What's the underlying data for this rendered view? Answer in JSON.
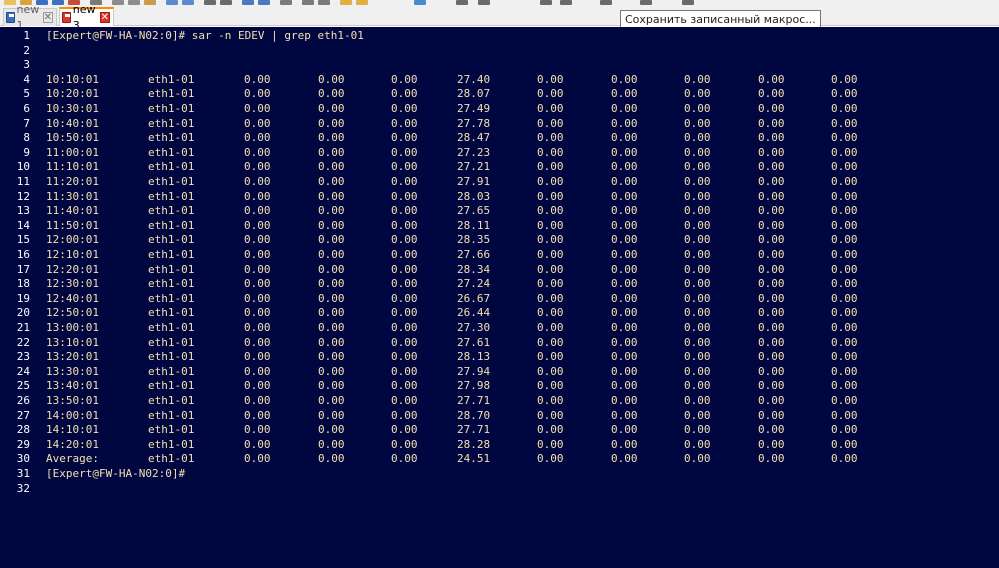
{
  "window": {
    "tabs": [
      {
        "label": "new 1",
        "active": false,
        "icon": "save-disk-icon"
      },
      {
        "label": "new 3",
        "active": true,
        "icon": "unsaved-disk-icon"
      }
    ],
    "tooltip": "Сохранить записанный макрос..."
  },
  "colors": {
    "editor_background": "#000640",
    "text": "#f3e0b0",
    "line_number": "#ffffff",
    "active_tab_accent": "#ff8a00"
  },
  "editor": {
    "command_line": {
      "line": "1",
      "text": "[Expert@FW-HA-N02:0]# sar -n EDEV | grep eth1-01"
    },
    "blank_lines": [
      "2",
      "3"
    ],
    "rows": [
      {
        "line": "4",
        "time": "10:10:01",
        "iface": "eth1-01",
        "values": [
          "0.00",
          "0.00",
          "0.00",
          "27.40",
          "0.00",
          "0.00",
          "0.00",
          "0.00",
          "0.00"
        ]
      },
      {
        "line": "5",
        "time": "10:20:01",
        "iface": "eth1-01",
        "values": [
          "0.00",
          "0.00",
          "0.00",
          "28.07",
          "0.00",
          "0.00",
          "0.00",
          "0.00",
          "0.00"
        ]
      },
      {
        "line": "6",
        "time": "10:30:01",
        "iface": "eth1-01",
        "values": [
          "0.00",
          "0.00",
          "0.00",
          "27.49",
          "0.00",
          "0.00",
          "0.00",
          "0.00",
          "0.00"
        ]
      },
      {
        "line": "7",
        "time": "10:40:01",
        "iface": "eth1-01",
        "values": [
          "0.00",
          "0.00",
          "0.00",
          "27.78",
          "0.00",
          "0.00",
          "0.00",
          "0.00",
          "0.00"
        ]
      },
      {
        "line": "8",
        "time": "10:50:01",
        "iface": "eth1-01",
        "values": [
          "0.00",
          "0.00",
          "0.00",
          "28.47",
          "0.00",
          "0.00",
          "0.00",
          "0.00",
          "0.00"
        ]
      },
      {
        "line": "9",
        "time": "11:00:01",
        "iface": "eth1-01",
        "values": [
          "0.00",
          "0.00",
          "0.00",
          "27.23",
          "0.00",
          "0.00",
          "0.00",
          "0.00",
          "0.00"
        ]
      },
      {
        "line": "10",
        "time": "11:10:01",
        "iface": "eth1-01",
        "values": [
          "0.00",
          "0.00",
          "0.00",
          "27.21",
          "0.00",
          "0.00",
          "0.00",
          "0.00",
          "0.00"
        ]
      },
      {
        "line": "11",
        "time": "11:20:01",
        "iface": "eth1-01",
        "values": [
          "0.00",
          "0.00",
          "0.00",
          "27.91",
          "0.00",
          "0.00",
          "0.00",
          "0.00",
          "0.00"
        ]
      },
      {
        "line": "12",
        "time": "11:30:01",
        "iface": "eth1-01",
        "values": [
          "0.00",
          "0.00",
          "0.00",
          "28.03",
          "0.00",
          "0.00",
          "0.00",
          "0.00",
          "0.00"
        ]
      },
      {
        "line": "13",
        "time": "11:40:01",
        "iface": "eth1-01",
        "values": [
          "0.00",
          "0.00",
          "0.00",
          "27.65",
          "0.00",
          "0.00",
          "0.00",
          "0.00",
          "0.00"
        ]
      },
      {
        "line": "14",
        "time": "11:50:01",
        "iface": "eth1-01",
        "values": [
          "0.00",
          "0.00",
          "0.00",
          "28.11",
          "0.00",
          "0.00",
          "0.00",
          "0.00",
          "0.00"
        ]
      },
      {
        "line": "15",
        "time": "12:00:01",
        "iface": "eth1-01",
        "values": [
          "0.00",
          "0.00",
          "0.00",
          "28.35",
          "0.00",
          "0.00",
          "0.00",
          "0.00",
          "0.00"
        ]
      },
      {
        "line": "16",
        "time": "12:10:01",
        "iface": "eth1-01",
        "values": [
          "0.00",
          "0.00",
          "0.00",
          "27.66",
          "0.00",
          "0.00",
          "0.00",
          "0.00",
          "0.00"
        ]
      },
      {
        "line": "17",
        "time": "12:20:01",
        "iface": "eth1-01",
        "values": [
          "0.00",
          "0.00",
          "0.00",
          "28.34",
          "0.00",
          "0.00",
          "0.00",
          "0.00",
          "0.00"
        ]
      },
      {
        "line": "18",
        "time": "12:30:01",
        "iface": "eth1-01",
        "values": [
          "0.00",
          "0.00",
          "0.00",
          "27.24",
          "0.00",
          "0.00",
          "0.00",
          "0.00",
          "0.00"
        ]
      },
      {
        "line": "19",
        "time": "12:40:01",
        "iface": "eth1-01",
        "values": [
          "0.00",
          "0.00",
          "0.00",
          "26.67",
          "0.00",
          "0.00",
          "0.00",
          "0.00",
          "0.00"
        ]
      },
      {
        "line": "20",
        "time": "12:50:01",
        "iface": "eth1-01",
        "values": [
          "0.00",
          "0.00",
          "0.00",
          "26.44",
          "0.00",
          "0.00",
          "0.00",
          "0.00",
          "0.00"
        ]
      },
      {
        "line": "21",
        "time": "13:00:01",
        "iface": "eth1-01",
        "values": [
          "0.00",
          "0.00",
          "0.00",
          "27.30",
          "0.00",
          "0.00",
          "0.00",
          "0.00",
          "0.00"
        ]
      },
      {
        "line": "22",
        "time": "13:10:01",
        "iface": "eth1-01",
        "values": [
          "0.00",
          "0.00",
          "0.00",
          "27.61",
          "0.00",
          "0.00",
          "0.00",
          "0.00",
          "0.00"
        ]
      },
      {
        "line": "23",
        "time": "13:20:01",
        "iface": "eth1-01",
        "values": [
          "0.00",
          "0.00",
          "0.00",
          "28.13",
          "0.00",
          "0.00",
          "0.00",
          "0.00",
          "0.00"
        ]
      },
      {
        "line": "24",
        "time": "13:30:01",
        "iface": "eth1-01",
        "values": [
          "0.00",
          "0.00",
          "0.00",
          "27.94",
          "0.00",
          "0.00",
          "0.00",
          "0.00",
          "0.00"
        ]
      },
      {
        "line": "25",
        "time": "13:40:01",
        "iface": "eth1-01",
        "values": [
          "0.00",
          "0.00",
          "0.00",
          "27.98",
          "0.00",
          "0.00",
          "0.00",
          "0.00",
          "0.00"
        ]
      },
      {
        "line": "26",
        "time": "13:50:01",
        "iface": "eth1-01",
        "values": [
          "0.00",
          "0.00",
          "0.00",
          "27.71",
          "0.00",
          "0.00",
          "0.00",
          "0.00",
          "0.00"
        ]
      },
      {
        "line": "27",
        "time": "14:00:01",
        "iface": "eth1-01",
        "values": [
          "0.00",
          "0.00",
          "0.00",
          "28.70",
          "0.00",
          "0.00",
          "0.00",
          "0.00",
          "0.00"
        ]
      },
      {
        "line": "28",
        "time": "14:10:01",
        "iface": "eth1-01",
        "values": [
          "0.00",
          "0.00",
          "0.00",
          "27.71",
          "0.00",
          "0.00",
          "0.00",
          "0.00",
          "0.00"
        ]
      },
      {
        "line": "29",
        "time": "14:20:01",
        "iface": "eth1-01",
        "values": [
          "0.00",
          "0.00",
          "0.00",
          "28.28",
          "0.00",
          "0.00",
          "0.00",
          "0.00",
          "0.00"
        ]
      },
      {
        "line": "30",
        "time": "Average:",
        "iface": "eth1-01",
        "values": [
          "0.00",
          "0.00",
          "0.00",
          "24.51",
          "0.00",
          "0.00",
          "0.00",
          "0.00",
          "0.00"
        ]
      }
    ],
    "prompt_line": {
      "line": "31",
      "text": "[Expert@FW-HA-N02:0]#"
    },
    "trailing_blank_lines": [
      "32"
    ]
  }
}
